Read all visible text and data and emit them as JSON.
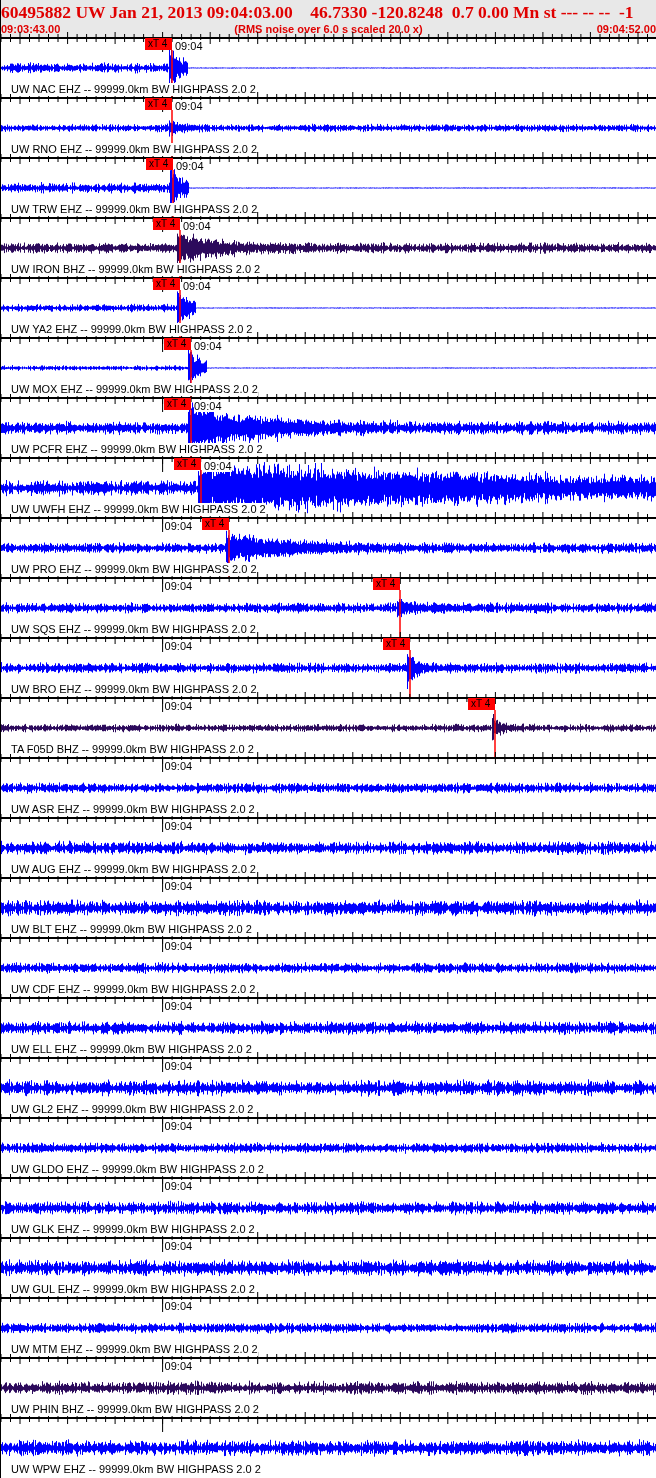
{
  "header": {
    "title": "60495882 UW Jan 21, 2013 09:04:03.00    46.7330 -120.8248  0.7 0.00 Mn st --- -- --  -1",
    "start_time": "09:03:43.00",
    "note": "(RMS noise over 6.0 s scaled 20.0 x)",
    "end_time": "09:04:52.00"
  },
  "traces": [
    {
      "label": "UW NAC EHZ -- 99999.0km BW HIGHPASS 2.0 2",
      "time_label": "09:04",
      "color": "#0000ff",
      "pick": {
        "label": "xT 4"
      }
    },
    {
      "label": "UW RNO EHZ -- 99999.0km BW HIGHPASS 2.0 2",
      "time_label": "09:04",
      "color": "#0000ff",
      "pick": {
        "label": "xT 4"
      }
    },
    {
      "label": "UW TRW EHZ -- 99999.0km BW HIGHPASS 2.0 2",
      "time_label": "09:04",
      "color": "#0000ff",
      "pick": {
        "label": "xT 4"
      }
    },
    {
      "label": "UW IRON BHZ -- 99999.0km BW HIGHPASS 2.0 2",
      "time_label": "09:04",
      "color": "#2c0a5c",
      "pick": {
        "label": "xT 4"
      }
    },
    {
      "label": "UW YA2 EHZ -- 99999.0km BW HIGHPASS 2.0 2",
      "time_label": "09:04",
      "color": "#0000ff",
      "pick": {
        "label": "xT 4"
      }
    },
    {
      "label": "UW MOX EHZ -- 99999.0km BW HIGHPASS 2.0 2",
      "time_label": "09:04",
      "color": "#0000ff",
      "pick": {
        "label": "xT 4"
      }
    },
    {
      "label": "UW PCFR EHZ -- 99999.0km BW HIGHPASS 2.0 2",
      "time_label": "09:04",
      "color": "#0000ff",
      "pick": {
        "label": "xT 4"
      }
    },
    {
      "label": "UW UWFH EHZ -- 99999.0km BW HIGHPASS 2.0 2",
      "time_label": "09:04",
      "color": "#0000ff",
      "pick": {
        "label": "xT 4"
      }
    },
    {
      "label": "UW PRO EHZ -- 99999.0km BW HIGHPASS 2.0 2",
      "time_label": "09:04",
      "color": "#0000ff",
      "pick": {
        "label": "xT 4"
      }
    },
    {
      "label": "UW SQS EHZ -- 99999.0km BW HIGHPASS 2.0 2",
      "time_label": "09:04",
      "color": "#0000ff",
      "pick": {
        "label": "xT 4"
      }
    },
    {
      "label": "UW BRO EHZ -- 99999.0km BW HIGHPASS 2.0 2",
      "time_label": "09:04",
      "color": "#0000ff",
      "pick": {
        "label": "xT 4"
      }
    },
    {
      "label": "TA F05D BHZ -- 99999.0km BW HIGHPASS 2.0 2",
      "time_label": "09:04",
      "color": "#2c0a5c",
      "pick": {
        "label": "xT 4"
      }
    },
    {
      "label": "UW ASR EHZ -- 99999.0km BW HIGHPASS 2.0 2",
      "time_label": "09:04",
      "color": "#0000ff"
    },
    {
      "label": "UW AUG EHZ -- 99999.0km BW HIGHPASS 2.0 2",
      "time_label": "09:04",
      "color": "#0000ff"
    },
    {
      "label": "UW BLT EHZ -- 99999.0km BW HIGHPASS 2.0 2",
      "time_label": "09:04",
      "color": "#0000ff"
    },
    {
      "label": "UW CDF EHZ -- 99999.0km BW HIGHPASS 2.0 2",
      "time_label": "09:04",
      "color": "#0000ff"
    },
    {
      "label": "UW ELL EHZ -- 99999.0km BW HIGHPASS 2.0 2",
      "time_label": "09:04",
      "color": "#0000ff"
    },
    {
      "label": "UW GL2 EHZ -- 99999.0km BW HIGHPASS 2.0 2",
      "time_label": "09:04",
      "color": "#0000ff"
    },
    {
      "label": "UW GLDO EHZ -- 99999.0km BW HIGHPASS 2.0 2",
      "time_label": "09:04",
      "color": "#0000ff"
    },
    {
      "label": "UW GLK EHZ -- 99999.0km BW HIGHPASS 2.0 2",
      "time_label": "09:04",
      "color": "#0000ff"
    },
    {
      "label": "UW GUL EHZ -- 99999.0km BW HIGHPASS 2.0 2",
      "time_label": "09:04",
      "color": "#0000ff"
    },
    {
      "label": "UW MTM EHZ -- 99999.0km BW HIGHPASS 2.0 2",
      "time_label": "09:04",
      "color": "#0000ff"
    },
    {
      "label": "UW PHIN BHZ -- 99999.0km BW HIGHPASS 2.0 2",
      "time_label": "09:04",
      "color": "#2c0a5c"
    },
    {
      "label": "UW WPW EHZ -- 99999.0km BW HIGHPASS 2.0 2",
      "color": "#0000ff"
    }
  ]
}
